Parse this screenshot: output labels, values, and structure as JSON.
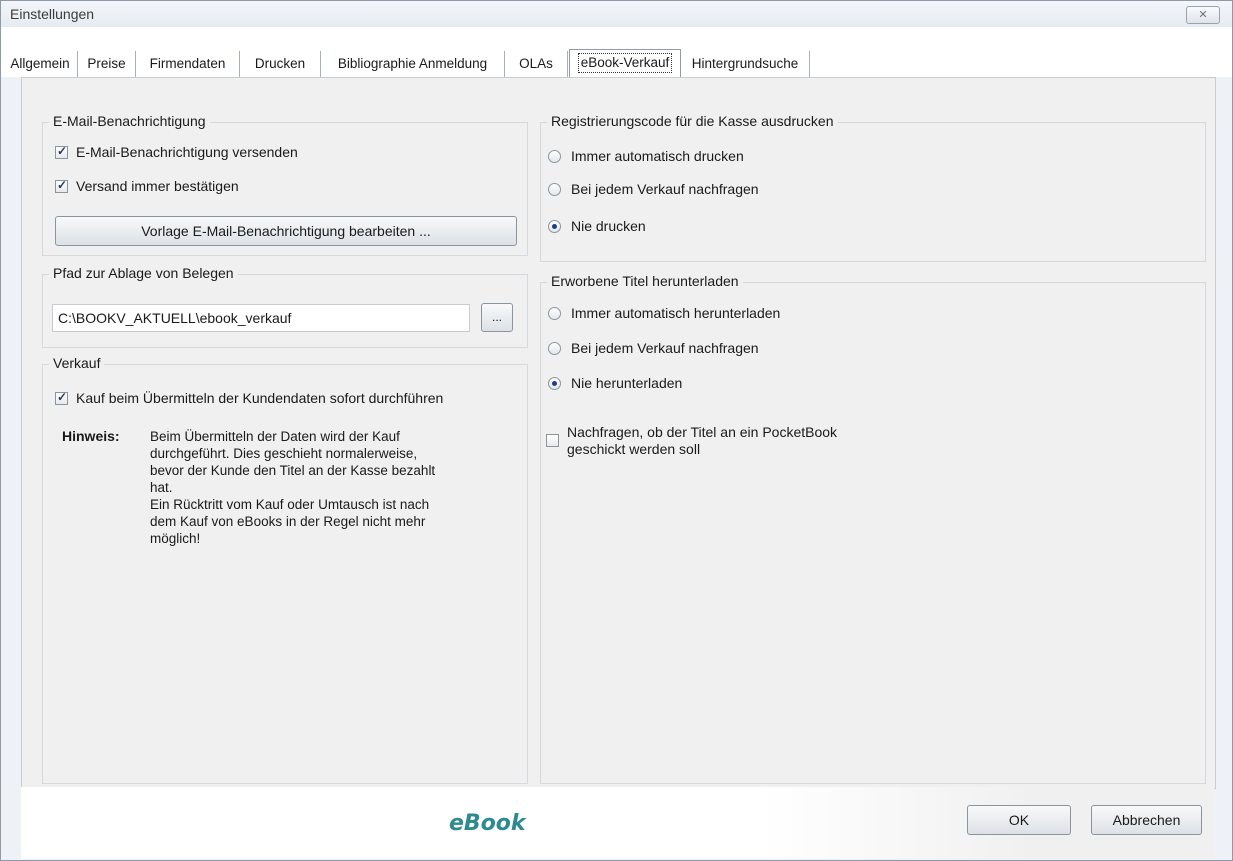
{
  "window": {
    "title": "Einstellungen",
    "close_glyph": "✕"
  },
  "tabs": [
    {
      "label": "Allgemein"
    },
    {
      "label": "Preise"
    },
    {
      "label": "Firmendaten"
    },
    {
      "label": "Drucken"
    },
    {
      "label": "Bibliographie Anmeldung"
    },
    {
      "label": "OLAs"
    },
    {
      "label": "eBook-Verkauf"
    },
    {
      "label": "Hintergrundsuche"
    }
  ],
  "email_group": {
    "title": "E-Mail-Benachrichtigung",
    "send_label": "E-Mail-Benachrichtigung versenden",
    "send_checked": true,
    "confirm_label": "Versand immer bestätigen",
    "confirm_checked": true,
    "edit_template_button": "Vorlage E-Mail-Benachrichtigung bearbeiten ..."
  },
  "path_group": {
    "title": "Pfad zur Ablage von Belegen",
    "path_value": "C:\\BOOKV_AKTUELL\\ebook_verkauf",
    "browse_button": "..."
  },
  "sale_group": {
    "title": "Verkauf",
    "immediate_label": "Kauf beim Übermitteln der Kundendaten sofort durchführen",
    "immediate_checked": true,
    "note_label": "Hinweis:",
    "note_text": "Beim Übermitteln der Daten wird der Kauf\ndurchgeführt. Dies geschieht normalerweise,\nbevor der Kunde den Titel an der Kasse bezahlt\nhat.\nEin Rücktritt vom Kauf oder Umtausch ist nach\ndem Kauf von eBooks in der Regel nicht mehr\nmöglich!"
  },
  "print_group": {
    "title": "Registrierungscode für die Kasse ausdrucken",
    "options": [
      {
        "label": "Immer automatisch drucken",
        "selected": false
      },
      {
        "label": "Bei jedem Verkauf nachfragen",
        "selected": false
      },
      {
        "label": "Nie drucken",
        "selected": true
      }
    ]
  },
  "download_group": {
    "title": "Erworbene Titel herunterladen",
    "options": [
      {
        "label": "Immer automatisch herunterladen",
        "selected": false
      },
      {
        "label": "Bei jedem Verkauf nachfragen",
        "selected": false
      },
      {
        "label": "Nie herunterladen",
        "selected": true
      }
    ],
    "pocketbook_label_line1": "Nachfragen, ob der Titel an ein PocketBook",
    "pocketbook_label_line2": "geschickt werden soll",
    "pocketbook_checked": false
  },
  "footer": {
    "logo_text": "eBook",
    "ok_button": "OK",
    "cancel_button": "Abbrechen"
  }
}
